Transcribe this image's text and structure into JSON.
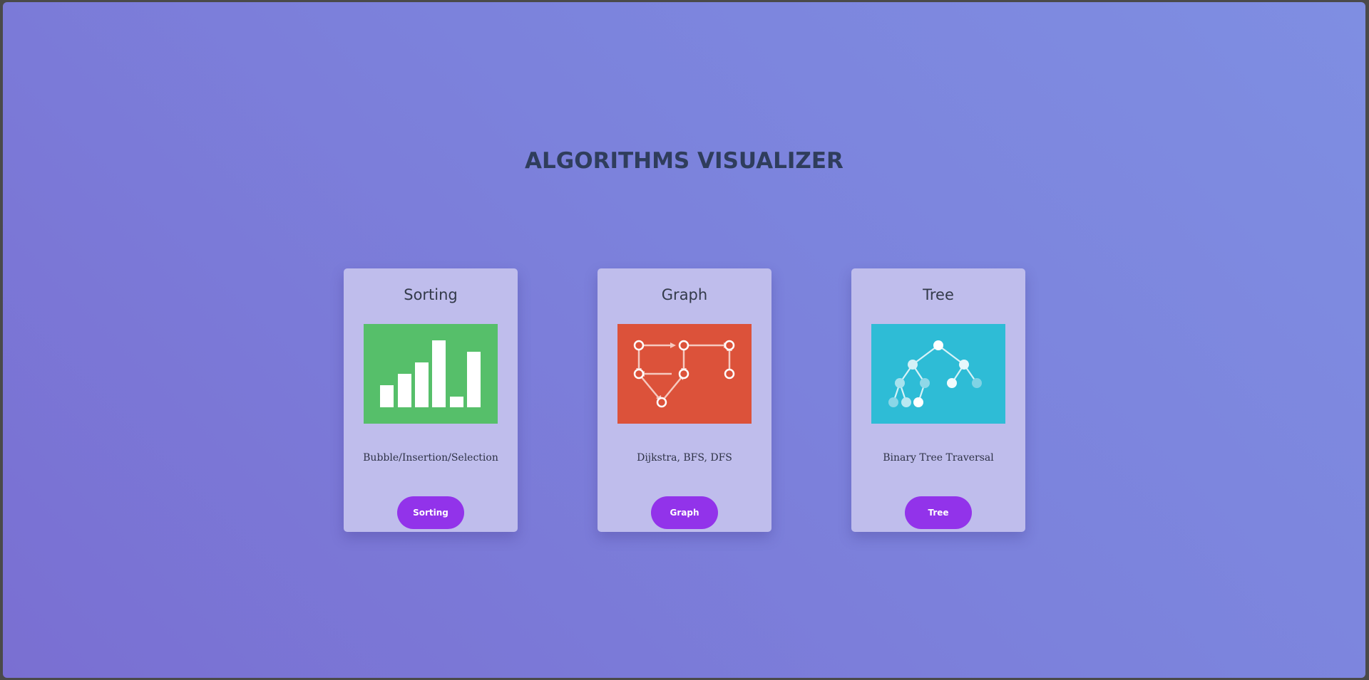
{
  "page": {
    "title": "ALGORITHMS VISUALIZER"
  },
  "cards": [
    {
      "title": "Sorting",
      "description": "Bubble/Insertion/Selection",
      "button_label": "Sorting",
      "image_icon": "bar-chart-icon",
      "image_color": "#56bf6a"
    },
    {
      "title": "Graph",
      "description": "Dijkstra, BFS, DFS",
      "button_label": "Graph",
      "image_icon": "graph-network-icon",
      "image_color": "#dc523a"
    },
    {
      "title": "Tree",
      "description": "Binary Tree Traversal",
      "button_label": "Tree",
      "image_icon": "binary-tree-icon",
      "image_color": "#2ebcd6"
    }
  ],
  "colors": {
    "title_text": "#2f3d5c",
    "card_bg": "#bfbdec",
    "button_bg": "#9233ea",
    "button_text": "#ffffff"
  }
}
